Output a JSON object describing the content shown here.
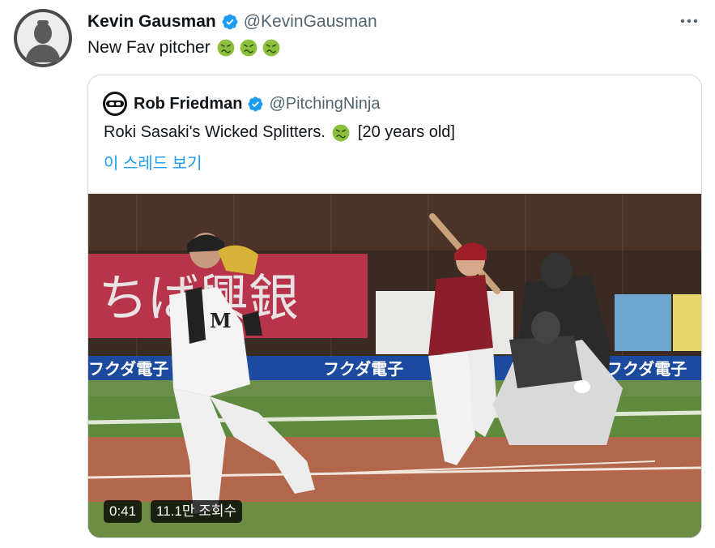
{
  "tweet": {
    "author_name": "Kevin Gausman",
    "author_handle": "@KevinGausman",
    "text": "New Fav pitcher",
    "emojis": [
      "nauseated-face",
      "nauseated-face",
      "nauseated-face"
    ],
    "more_icon": "more-horizontal-icon",
    "verified_icon": "verified-badge-icon"
  },
  "quote": {
    "author_name": "Rob Friedman",
    "author_handle": "@PitchingNinja",
    "text": "Roki Sasaki's Wicked Splitters.",
    "text_suffix": "[20 years old]",
    "emoji": "nauseated-face",
    "thread_link": "이 스레드 보기",
    "video": {
      "duration": "0:41",
      "views": "11.1만 조회수",
      "signage": [
        "ちば興銀",
        "フクダ電子",
        "フクダ電子",
        "フクダ電子"
      ]
    }
  },
  "colors": {
    "accent": "#1d9bf0",
    "text": "#0f1419",
    "secondary": "#536471",
    "border": "#cfd9de",
    "emoji": "#8dbf3f"
  }
}
